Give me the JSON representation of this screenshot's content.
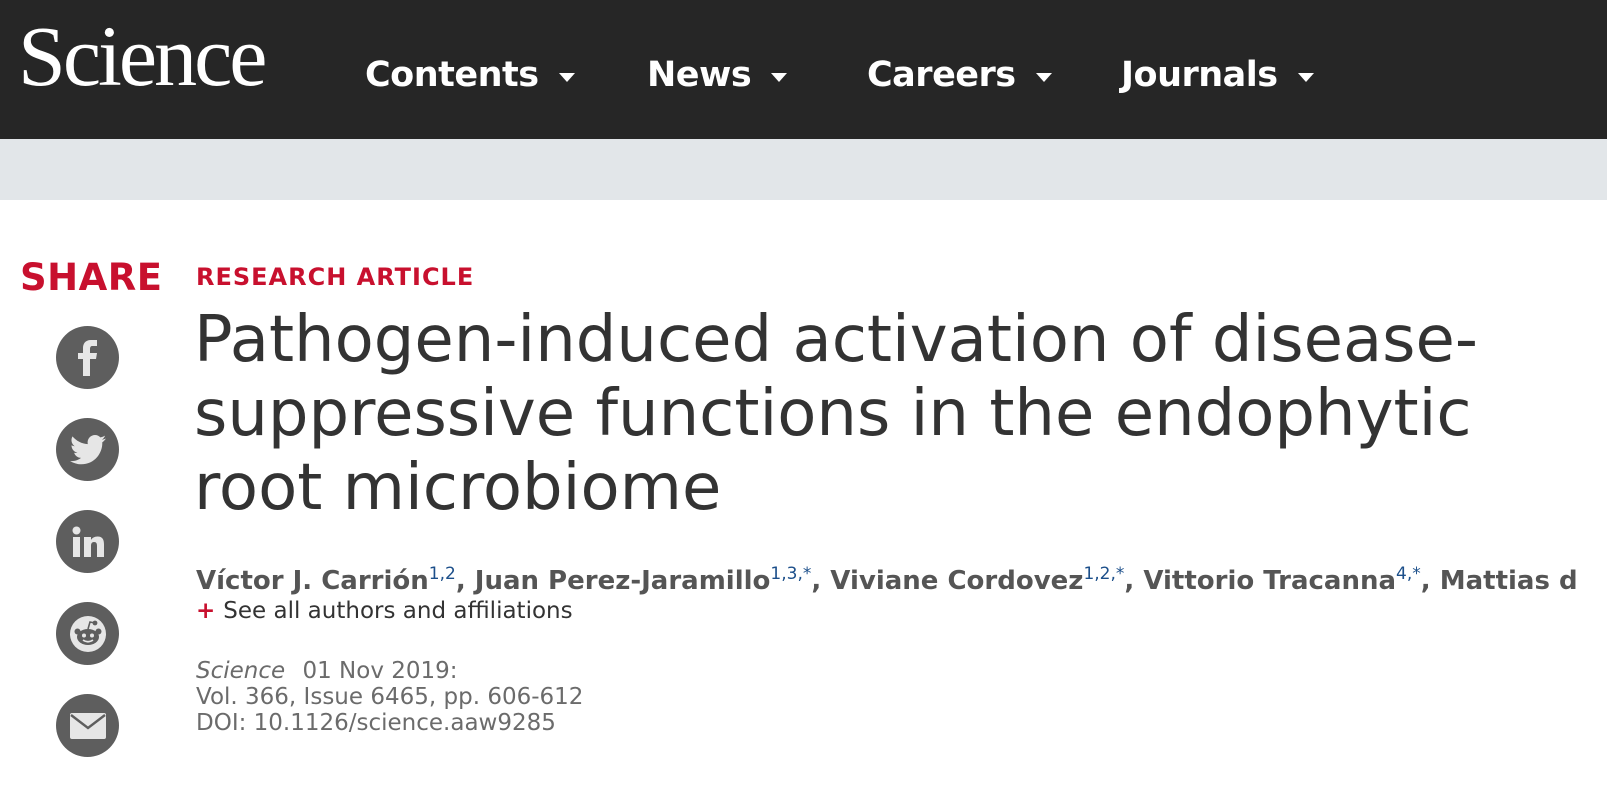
{
  "header": {
    "logo": "Science",
    "nav": [
      {
        "label": "Contents"
      },
      {
        "label": "News"
      },
      {
        "label": "Careers"
      },
      {
        "label": "Journals"
      }
    ]
  },
  "share": {
    "label": "SHARE",
    "buttons": [
      "facebook-icon",
      "twitter-icon",
      "linkedin-icon",
      "reddit-icon",
      "email-icon"
    ]
  },
  "article": {
    "kicker": "RESEARCH ARTICLE",
    "title": "Pathogen-induced activation of disease-suppressive functions in the endophytic root microbiome",
    "authors": [
      {
        "name": "Víctor J. Carrión",
        "sup": "1,2"
      },
      {
        "name": "Juan Perez-Jaramillo",
        "sup": "1,3,*"
      },
      {
        "name": "Viviane Cordovez",
        "sup": "1,2,*"
      },
      {
        "name": "Vittorio Tracanna",
        "sup": "4,*"
      },
      {
        "name": "Mattias d..."
      }
    ],
    "see_all": "See all authors and affiliations",
    "citation": {
      "journal": "Science",
      "date": "01 Nov 2019:",
      "volume": "Vol. 366, Issue 6465, pp. 606-612",
      "doi": "DOI: 10.1126/science.aaw9285"
    }
  },
  "colors": {
    "topbar": "#262626",
    "accent_red": "#c8102e",
    "subbar": "#e2e6e9",
    "share_button": "#5e5e5e"
  }
}
